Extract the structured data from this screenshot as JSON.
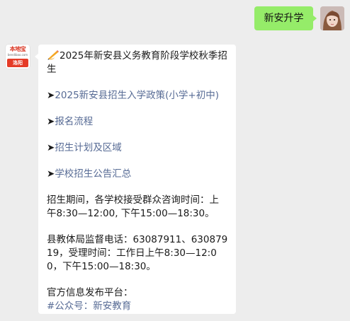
{
  "user_message": {
    "text": "新安升学"
  },
  "bot_avatar": {
    "brand": "本地宝",
    "site": "bendibao.com",
    "city": "洛阳"
  },
  "bot_message": {
    "title": "2025年新安县义务教育阶段学校秋季招生",
    "arrow": "➤",
    "links": [
      "2025新安县招生入学政策(小学+初中)",
      "报名流程",
      "招生计划及区域",
      "学校招生公告汇总"
    ],
    "consult_text": "招生期间，各学校接受群众咨询时间：上午8:30—12:00, 下午15:00—18:30。",
    "phone_text": "县教体局监督电话：63087911、63087919，受理时间：工作日上午8:30—12:00，下午15:00—18:30。",
    "official_label": "官方信息发布平台：",
    "official_link": "#公众号：新安教育"
  },
  "colors": {
    "user_bubble": "#95ec69",
    "link": "#576b95",
    "background": "#ededed"
  }
}
